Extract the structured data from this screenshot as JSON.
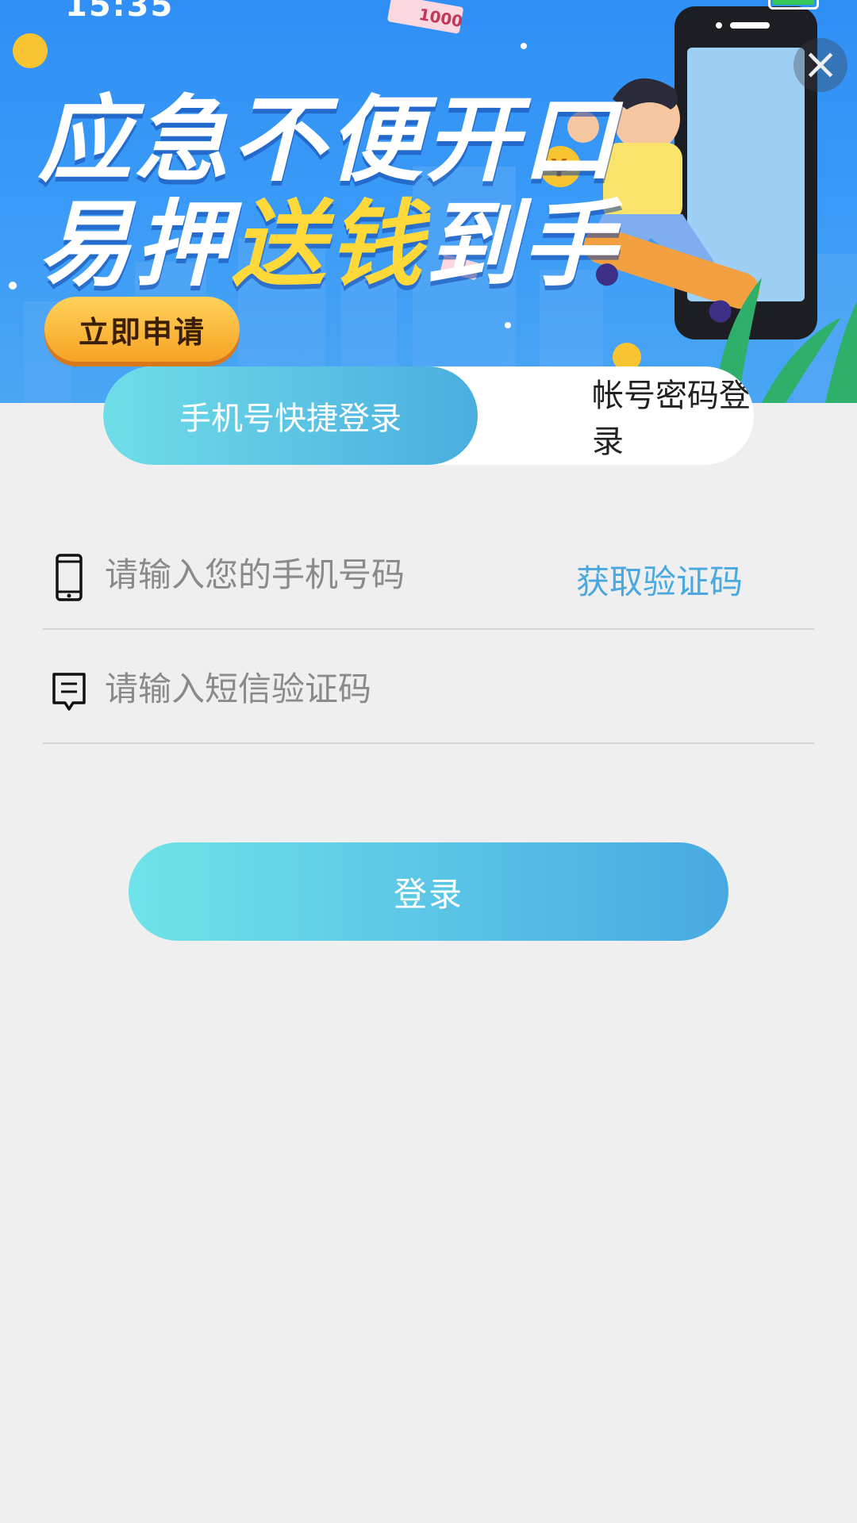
{
  "status_bar": {
    "time": "15:35"
  },
  "banner": {
    "slogan_line1": "应急不便开口",
    "slogan_line2_part1": "易押",
    "slogan_line2_highlight": "送钱",
    "slogan_line2_part2": "到手",
    "apply_button": "立即申请",
    "close_icon": "close-icon",
    "banknote_label": "1000",
    "coin_symbol": "¥"
  },
  "tabs": [
    {
      "label": "手机号快捷登录",
      "active": true
    },
    {
      "label": "帐号密码登录",
      "active": false
    }
  ],
  "form": {
    "phone_placeholder": "请输入您的手机号码",
    "phone_icon": "phone-icon",
    "get_code": "获取验证码",
    "sms_placeholder": "请输入短信验证码",
    "sms_icon": "message-icon",
    "login_button": "登录"
  },
  "colors": {
    "accent": "#4aaedf",
    "accent_light": "#6fdde8",
    "banner_blue": "#2f8ff5",
    "highlight_yellow": "#ffd83a",
    "background": "#efefef"
  }
}
